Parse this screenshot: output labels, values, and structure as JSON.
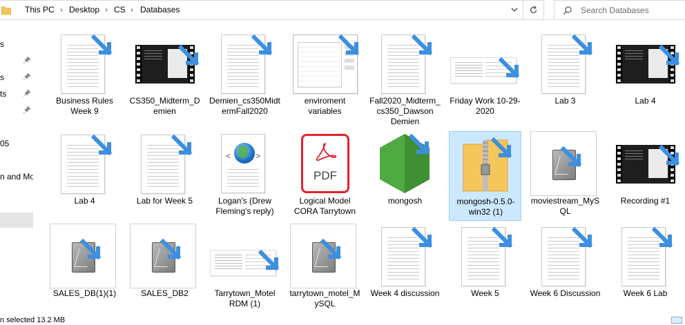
{
  "address": {
    "crumbs": [
      "This PC",
      "Desktop",
      "CS",
      "Databases"
    ],
    "separator": "›"
  },
  "search": {
    "placeholder": "Search Databases"
  },
  "nav": {
    "items": [
      "s",
      "s",
      "ts",
      "",
      "05",
      "n and Mod"
    ]
  },
  "files": [
    {
      "label": "Business Rules Week 9",
      "type": "document"
    },
    {
      "label": "CS350_Midterm_Demien",
      "type": "video"
    },
    {
      "label": "Demien_cs350MidtermFall2020",
      "type": "document"
    },
    {
      "label": "enviroment variables",
      "type": "screenshot"
    },
    {
      "label": "Fall2020_Midterm_cs350_Dawson Demien",
      "type": "document"
    },
    {
      "label": "Friday Work 10-29-2020",
      "type": "screenshot"
    },
    {
      "label": "Lab 3",
      "type": "document"
    },
    {
      "label": "Lab 4",
      "type": "video"
    },
    {
      "label": "Lab 4",
      "type": "document"
    },
    {
      "label": "Lab for Week 5",
      "type": "document"
    },
    {
      "label": "Logan's (Drew Fleming's reply)",
      "type": "html"
    },
    {
      "label": "Logical Model CORA Tarrytown",
      "type": "pdf"
    },
    {
      "label": "mongosh",
      "type": "mongo"
    },
    {
      "label": "mongosh-0.5.0-win32 (1)",
      "type": "zip",
      "selected": true
    },
    {
      "label": "moviestream_MySQL",
      "type": "db"
    },
    {
      "label": "Recording #1",
      "type": "video"
    },
    {
      "label": "SALES_DB(1)(1)",
      "type": "db"
    },
    {
      "label": "SALES_DB2",
      "type": "db"
    },
    {
      "label": "Tarrytown_Motel RDM (1)",
      "type": "screenshot"
    },
    {
      "label": "tarrytown_motel_MySQL",
      "type": "db"
    },
    {
      "label": "Week 4 discussion",
      "type": "document"
    },
    {
      "label": "Week 5",
      "type": "document"
    },
    {
      "label": "Week 6 Discussion",
      "type": "document"
    },
    {
      "label": "Week 6 Lab",
      "type": "document"
    }
  ],
  "pdf_badge": "PDF",
  "status": {
    "text": "n selected  13.2 MB"
  },
  "colors": {
    "shortcut_arrow": "#3d8fe0",
    "selection": "#cce8ff",
    "pdf_red": "#e8202a",
    "mongo_green": "#4faa41",
    "zip_yellow": "#f5c65a"
  }
}
